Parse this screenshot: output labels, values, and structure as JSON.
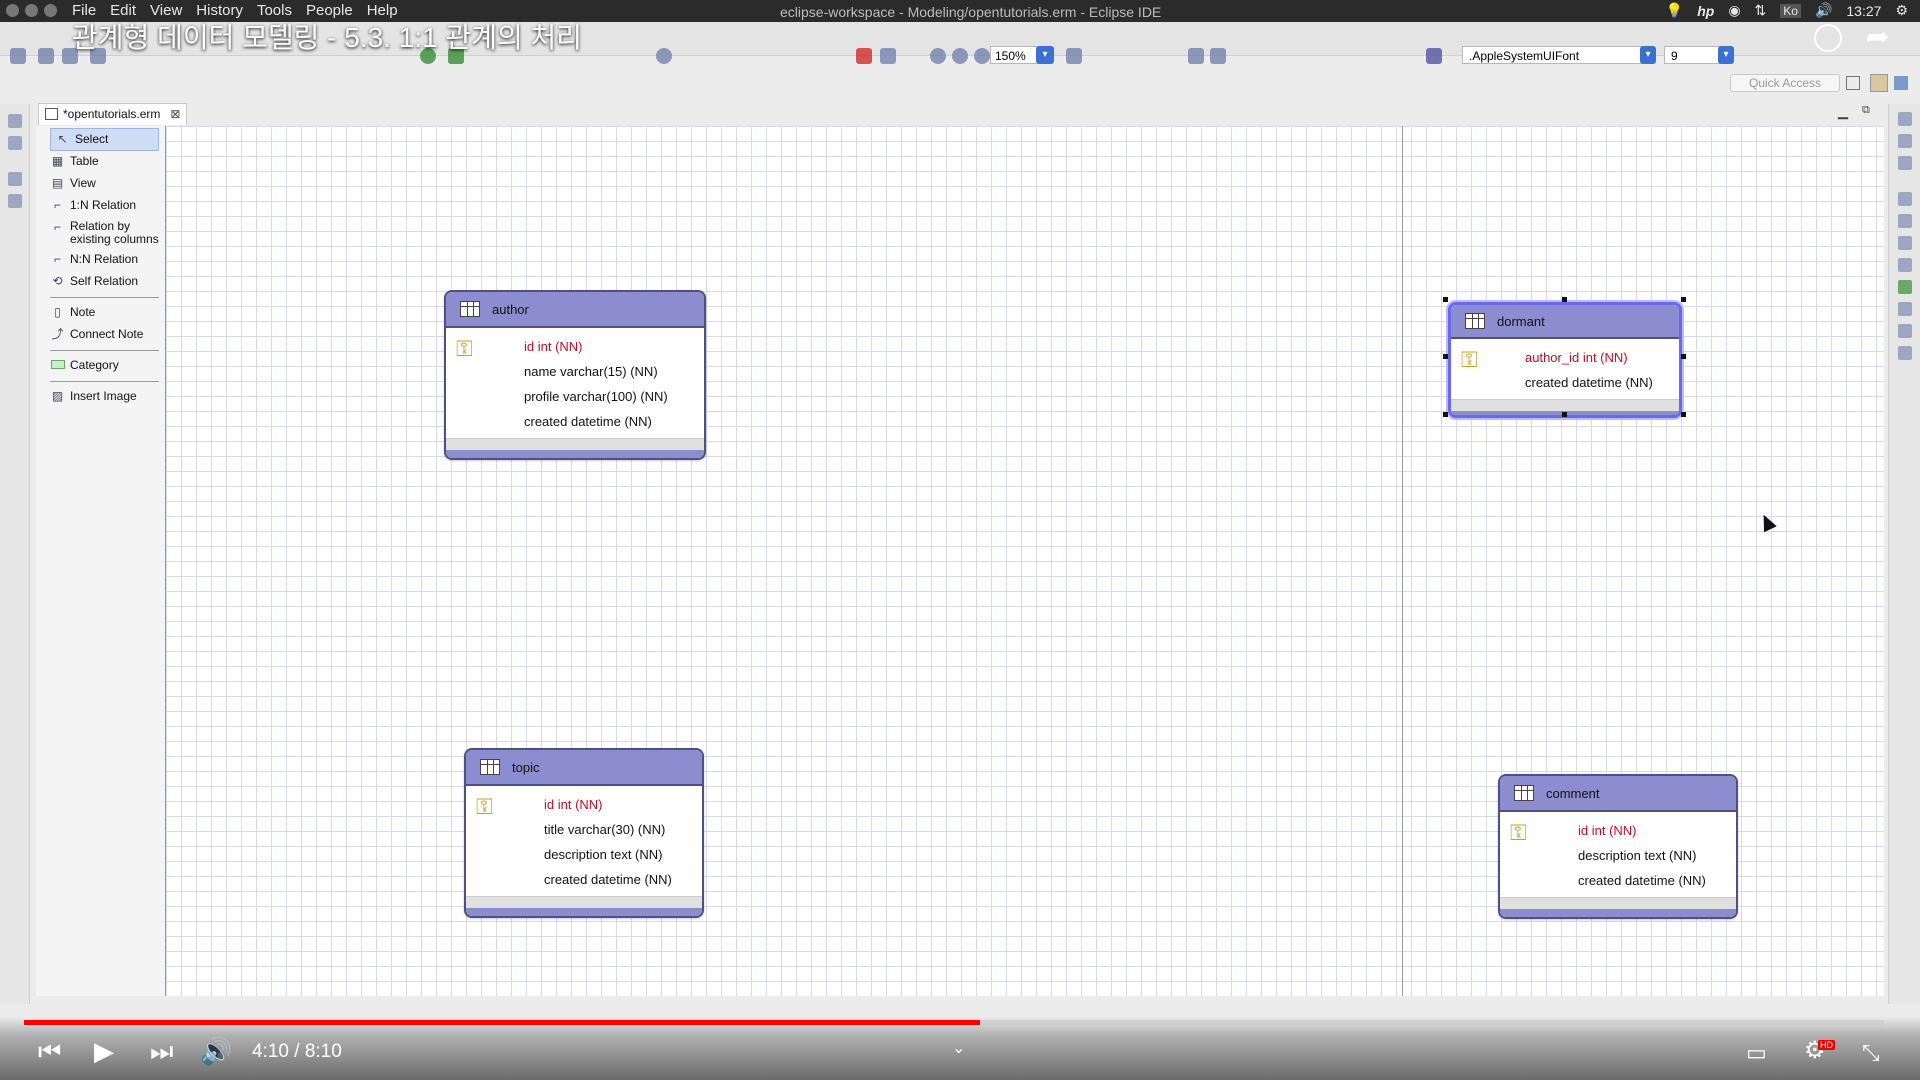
{
  "video": {
    "title": "관계형 데이터 모델링 - 5.3. 1:1 관계의 처리",
    "time": "4:10 / 8:10",
    "progress": 0.514
  },
  "system": {
    "menu": [
      "File",
      "Edit",
      "View",
      "History",
      "Tools",
      "People",
      "Help"
    ],
    "window_title": "eclipse-workspace - Modeling/opentutorials.erm - Eclipse IDE",
    "lang_indicator": "Ko",
    "clock": "13:27"
  },
  "toolbar": {
    "zoom": "150%",
    "font": ".AppleSystemUIFont",
    "font_size": "9",
    "quick_access": "Quick Access"
  },
  "editor": {
    "tab_label": "*opentutorials.erm"
  },
  "palette": {
    "items": [
      {
        "label": "Select",
        "icon": "select-arrow-icon"
      },
      {
        "label": "Table",
        "icon": "table-icon"
      },
      {
        "label": "View",
        "icon": "view-icon"
      },
      {
        "label": "1:N Relation",
        "icon": "relation-icon"
      },
      {
        "label": "Relation by existing columns",
        "icon": "relation-icon"
      },
      {
        "label": "N:N Relation",
        "icon": "relation-icon"
      },
      {
        "label": "Self Relation",
        "icon": "self-relation-icon"
      },
      {
        "label": "Note",
        "icon": "note-icon"
      },
      {
        "label": "Connect Note",
        "icon": "connect-note-icon"
      },
      {
        "label": "Category",
        "icon": "category-icon"
      },
      {
        "label": "Insert Image",
        "icon": "image-icon"
      }
    ]
  },
  "entities": {
    "author": {
      "name": "author",
      "columns": [
        "id int (NN)",
        "name varchar(15) (NN)",
        "profile varchar(100) (NN)",
        "created datetime (NN)"
      ]
    },
    "dormant": {
      "name": "dormant",
      "columns": [
        "author_id int (NN)",
        "created datetime (NN)"
      ]
    },
    "topic": {
      "name": "topic",
      "columns": [
        "id int (NN)",
        "title varchar(30) (NN)",
        "description text (NN)",
        "created datetime (NN)"
      ]
    },
    "comment": {
      "name": "comment",
      "columns": [
        "id int (NN)",
        "description text (NN)",
        "created datetime (NN)"
      ]
    }
  },
  "colors": {
    "entity_header": "#8c8cd0",
    "primary_key_text": "#c0102a",
    "progress": "#ff0000",
    "selection": "#6a6ae8"
  }
}
